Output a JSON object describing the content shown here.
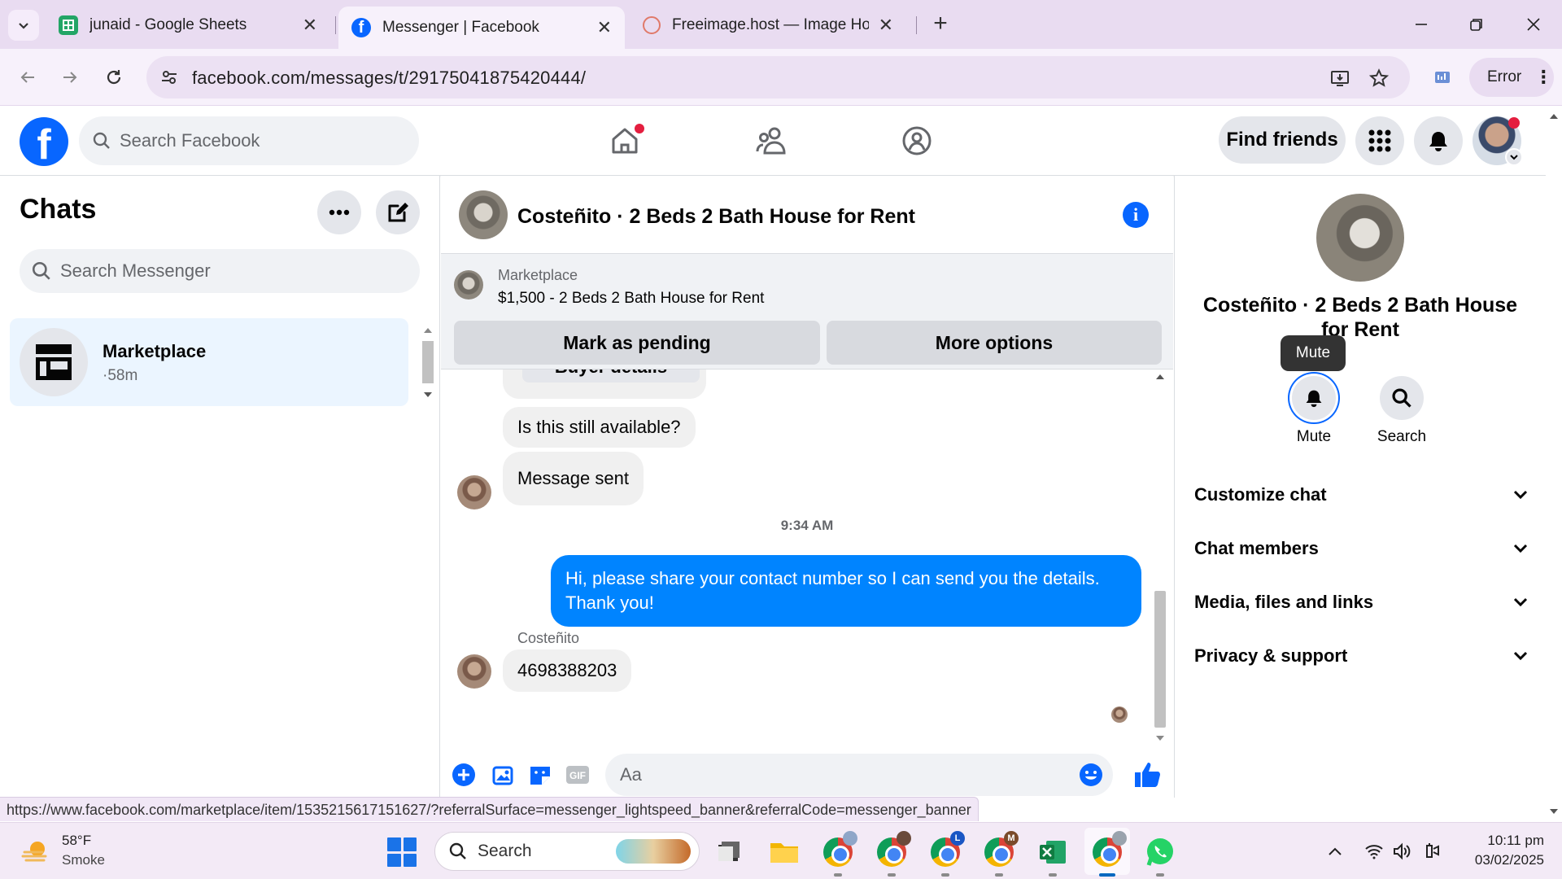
{
  "browser": {
    "tabs": [
      {
        "title": "junaid - Google Sheets",
        "icon": "google-sheets-icon",
        "active": false
      },
      {
        "title": "Messenger | Facebook",
        "icon": "facebook-icon",
        "active": true
      },
      {
        "title": "Freeimage.host — Image Hosting",
        "icon": "freeimage-icon",
        "active": false
      }
    ],
    "url": "facebook.com/messages/t/29175041875420444/",
    "profile_status": "Error"
  },
  "facebook": {
    "search_placeholder": "Search Facebook",
    "find_friends": "Find friends"
  },
  "chats": {
    "title": "Chats",
    "search_placeholder": "Search Messenger",
    "items": [
      {
        "name": "Marketplace",
        "meta": "·58m"
      }
    ]
  },
  "conversation": {
    "title": "Costeñito · 2 Beds 2 Bath House for Rent",
    "marketplace": {
      "label": "Marketplace",
      "listing": "$1,500 - 2 Beds 2 Bath House for Rent",
      "mark_pending": "Mark as pending",
      "more_options": "More options"
    },
    "messages": {
      "partial_button": "Buyer details",
      "q1": "Is this still available?",
      "sent": "Message sent",
      "timestamp": "9:34 AM",
      "outgoing": "Hi, please share your contact number so I can send you the details. Thank you!",
      "sender": "Costeñito",
      "reply": "4698388203"
    },
    "composer_placeholder": "Aa"
  },
  "info_panel": {
    "title": "Costeñito · 2 Beds 2 Bath House for Rent",
    "tooltip": "Mute",
    "actions": {
      "mute": "Mute",
      "search": "Search"
    },
    "sections": [
      "Customize chat",
      "Chat members",
      "Media, files and links",
      "Privacy & support"
    ]
  },
  "status_url": "https://www.facebook.com/marketplace/item/1535215617151627/?referralSurface=messenger_lightspeed_banner&referralCode=messenger_banner",
  "taskbar": {
    "weather_temp": "58°F",
    "weather_desc": "Smoke",
    "search_placeholder": "Search",
    "time": "10:11 pm",
    "date": "03/02/2025",
    "chrome_badges": [
      "",
      "",
      "L",
      "M",
      ""
    ]
  },
  "colors": {
    "facebook_blue": "#0866ff",
    "messenger_bubble": "#0084ff",
    "chrome_tab_bg": "#e9dcf1"
  }
}
